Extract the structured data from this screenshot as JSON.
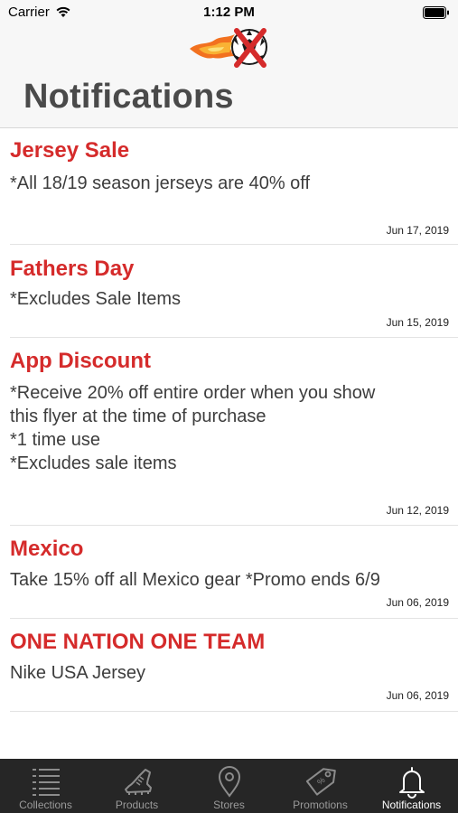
{
  "status": {
    "carrier": "Carrier",
    "time": "1:12 PM"
  },
  "header": {
    "title": "Notifications",
    "logo_icon": "flaming-soccer-ball-logo-icon"
  },
  "notifications": [
    {
      "title": "Jersey Sale",
      "lines": [
        "*All 18/19 season jerseys are 40% off"
      ],
      "date": "Jun 17, 2019"
    },
    {
      "title": "Fathers Day",
      "lines": [
        "*Excludes Sale Items"
      ],
      "date": "Jun 15, 2019"
    },
    {
      "title": "App Discount",
      "lines": [
        "*Receive 20% off entire order when you show",
        "this flyer at the time of purchase",
        "*1 time use",
        "*Excludes sale items"
      ],
      "date": "Jun 12, 2019"
    },
    {
      "title": "Mexico",
      "lines": [
        "Take 15% off all Mexico gear *Promo ends 6/9"
      ],
      "date": "Jun 06, 2019"
    },
    {
      "title": "ONE NATION ONE TEAM",
      "lines": [
        "Nike USA Jersey"
      ],
      "date": "Jun 06, 2019"
    }
  ],
  "tabs": [
    {
      "label": "Collections",
      "icon": "list-icon",
      "active": false
    },
    {
      "label": "Products",
      "icon": "cleat-icon",
      "active": false
    },
    {
      "label": "Stores",
      "icon": "map-pin-icon",
      "active": false
    },
    {
      "label": "Promotions",
      "icon": "tag-icon",
      "active": false
    },
    {
      "label": "Notifications",
      "icon": "bell-icon",
      "active": true
    }
  ],
  "colors": {
    "accent": "#d52b2b",
    "tab_bar": "#262626",
    "title_text": "#4a4a4a"
  }
}
